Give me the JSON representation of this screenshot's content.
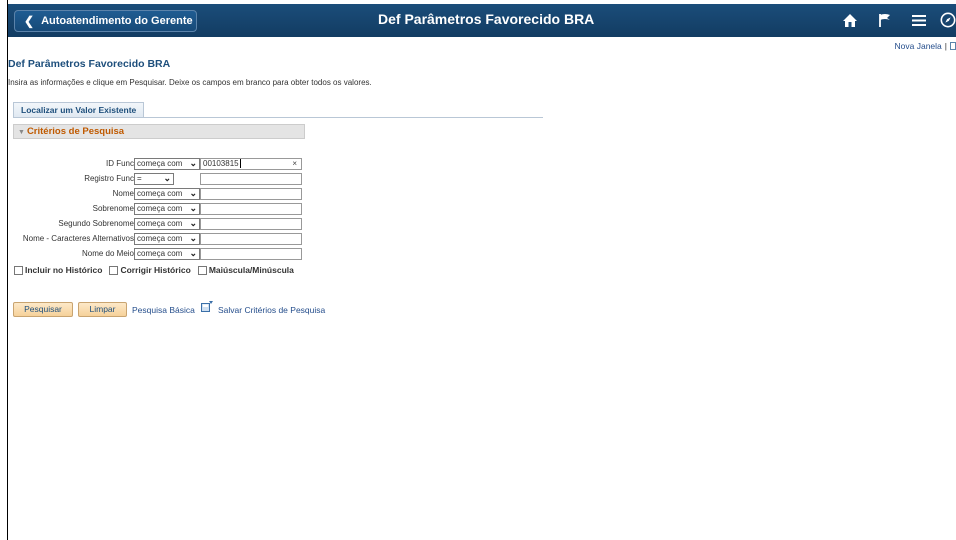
{
  "header": {
    "back_label": "Autoatendimento do Gerente",
    "title": "Def Parâmetros Favorecido BRA",
    "icons": [
      "home-icon",
      "flag-icon",
      "menu-icon",
      "navbar-icon"
    ]
  },
  "top_links": {
    "new_window": "Nova Janela",
    "separator": "|"
  },
  "page": {
    "title": "Def Parâmetros Favorecido BRA",
    "instructions": "Insira as informações e clique em Pesquisar. Deixe os campos em branco para obter todos os valores."
  },
  "tab": {
    "label": "Localizar um Valor Existente"
  },
  "criteria": {
    "header": "Critérios de Pesquisa",
    "fields": [
      {
        "label": "ID Func",
        "operator": "começa com",
        "value": "00103815"
      },
      {
        "label": "Registro Func",
        "operator": "=",
        "value": ""
      },
      {
        "label": "Nome",
        "operator": "começa com",
        "value": ""
      },
      {
        "label": "Sobrenome",
        "operator": "começa com",
        "value": ""
      },
      {
        "label": "Segundo Sobrenome",
        "operator": "começa com",
        "value": ""
      },
      {
        "label": "Nome - Caracteres Alternativos",
        "operator": "começa com",
        "value": ""
      },
      {
        "label": "Nome do Meio",
        "operator": "começa com",
        "value": ""
      }
    ],
    "clear_glyph": "×",
    "checkboxes": [
      "Incluir no Histórico",
      "Corrigir Histórico",
      "Maiúscula/Minúscula"
    ]
  },
  "actions": {
    "search": "Pesquisar",
    "clear": "Limpar",
    "basic_search": "Pesquisa Básica",
    "save_criteria": "Salvar Critérios de Pesquisa"
  },
  "colors": {
    "banner": "#1b4d7a",
    "accent_orange": "#c05a00",
    "link": "#254e8c",
    "button": "#f6d19a"
  }
}
